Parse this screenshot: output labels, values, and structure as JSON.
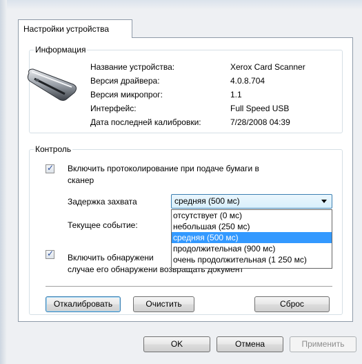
{
  "tab": {
    "label": "Настройки устройства"
  },
  "info": {
    "title": "Информация",
    "rows": [
      {
        "label": "Название устройства:",
        "value": "Xerox Card Scanner"
      },
      {
        "label": "Версия драйвера:",
        "value": "4.0.8.704"
      },
      {
        "label": "Версия микропрог:",
        "value": "1.1"
      },
      {
        "label": "Интерфейс:",
        "value": "Full Speed USB"
      },
      {
        "label": "Дата последней калибровки:",
        "value": "7/28/2008  04:39"
      }
    ]
  },
  "control": {
    "title": "Контроль",
    "logging_checkbox": {
      "label_line1": "Включить протоколирование при подаче бумаги в",
      "label_line2": "сканер",
      "checked": true
    },
    "capture_delay": {
      "label": "Задержка захвата",
      "selected": "средняя (500 мс)",
      "options": [
        "отсутствует (0 мс)",
        "небольшая (250 мс)",
        "средняя (500 мс)",
        "продолжительная (900 мс)",
        "очень продолжительная (1 250 мс)"
      ],
      "highlighted_index": 2
    },
    "current_event": {
      "label": "Текущее событие:"
    },
    "detect_checkbox": {
      "label_line1": "Включить обнаружени",
      "label_line2": "случае его обнаружени",
      "label_line2_tail": "возвращать документ",
      "checked": true
    }
  },
  "buttons": {
    "calibrate": "Откалибровать",
    "clear": "Очистить",
    "reset": "Сброс",
    "ok": "OK",
    "cancel": "Отмена",
    "apply": "Применить"
  }
}
